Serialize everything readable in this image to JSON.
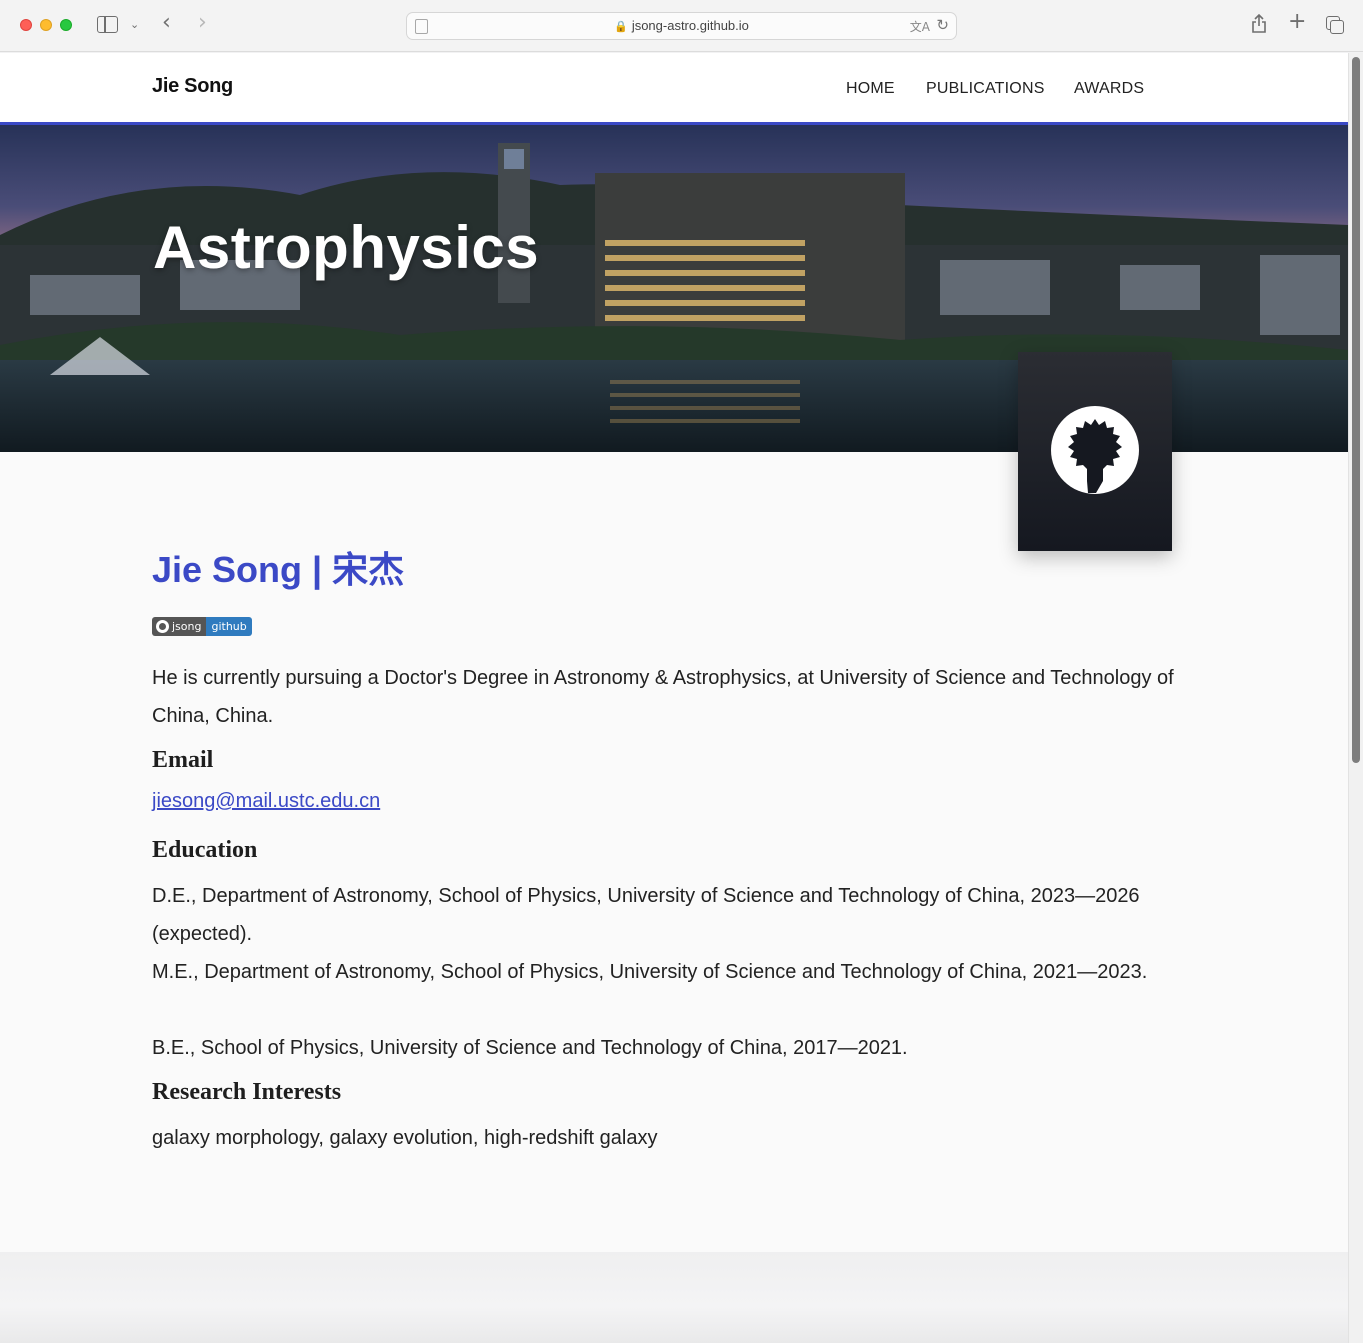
{
  "browser": {
    "url": "jsong-astro.github.io"
  },
  "navbar": {
    "brand": "Jie Song",
    "links": [
      {
        "label": "HOME"
      },
      {
        "label": "PUBLICATIONS"
      },
      {
        "label": "AWARDS"
      }
    ],
    "accent_color": "#3a49c6"
  },
  "hero": {
    "title": "Astrophysics"
  },
  "profile": {
    "name": "Jie Song  |  宋杰",
    "badge": {
      "left": "jsong",
      "right": "github"
    },
    "intro": "He is currently pursuing a Doctor's Degree in Astronomy & Astrophysics, at University of Science and Technology of China, China."
  },
  "sections": {
    "email": {
      "heading": "Email",
      "address": "jiesong@mail.ustc.edu.cn"
    },
    "education": {
      "heading": "Education",
      "items": [
        "D.E., Department of Astronomy, School of Physics, University of Science and Technology of China, 2023—2026 (expected).",
        "M.E., Department of Astronomy, School of Physics, University of Science and Technology of China, 2021—2023.",
        "B.E., School of Physics, University of Science and Technology of China, 2017—2021."
      ]
    },
    "research": {
      "heading": "Research Interests",
      "text": "galaxy morphology, galaxy evolution, high-redshift galaxy"
    }
  },
  "colors": {
    "link": "#3b49c6",
    "badge_right": "#2f7bbf",
    "badge_left": "#555555"
  }
}
